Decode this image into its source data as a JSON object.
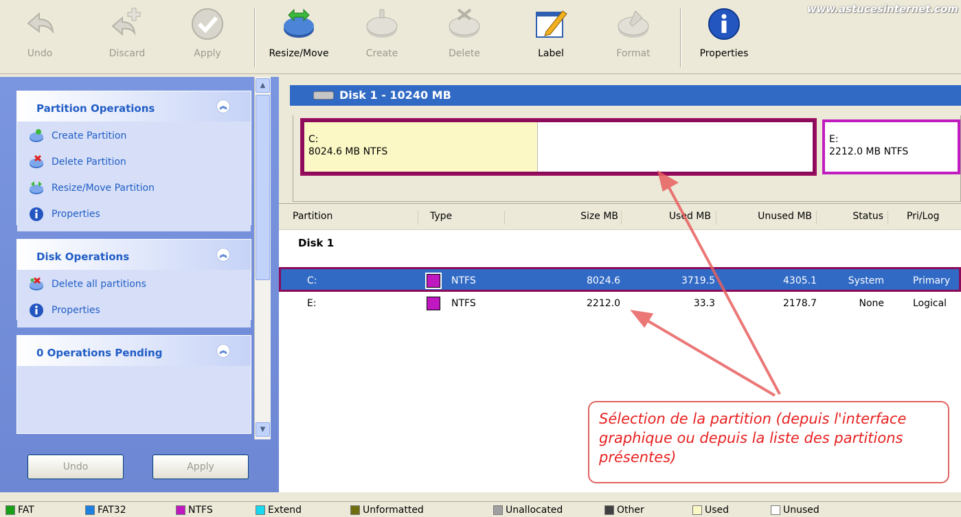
{
  "watermark": "www.astucesinternet.com",
  "toolbar": {
    "undo": "Undo",
    "discard": "Discard",
    "apply": "Apply",
    "resize_move": "Resize/Move",
    "create": "Create",
    "delete": "Delete",
    "label": "Label",
    "format": "Format",
    "properties": "Properties"
  },
  "sidebar": {
    "partition_ops": {
      "title": "Partition Operations",
      "items": [
        "Create Partition",
        "Delete Partition",
        "Resize/Move Partition",
        "Properties"
      ]
    },
    "disk_ops": {
      "title": "Disk Operations",
      "items": [
        "Delete all partitions",
        "Properties"
      ]
    },
    "pending": {
      "title": "0 Operations Pending"
    },
    "undo": "Undo",
    "apply": "Apply"
  },
  "disk": {
    "title": "Disk 1 - 10240 MB",
    "partC": {
      "letter": "C:",
      "info": "8024.6 MB  NTFS",
      "used_fraction": 0.46
    },
    "partE": {
      "letter": "E:",
      "info": "2212.0 MB  NTFS"
    }
  },
  "table": {
    "headers": [
      "Partition",
      "Type",
      "Size MB",
      "Used MB",
      "Unused MB",
      "Status",
      "Pri/Log"
    ],
    "disk_label": "Disk 1",
    "rows": [
      {
        "partition": "C:",
        "type": "NTFS",
        "size": "8024.6",
        "used": "3719.5",
        "unused": "4305.1",
        "status": "System",
        "prilog": "Primary"
      },
      {
        "partition": "E:",
        "type": "NTFS",
        "size": "2212.0",
        "used": "33.3",
        "unused": "2178.7",
        "status": "None",
        "prilog": "Logical"
      }
    ]
  },
  "callout": "Sélection de la partition (depuis l'interface graphique ou depuis la liste des partitions présentes)",
  "legend": [
    {
      "label": "FAT",
      "color": "#18a018"
    },
    {
      "label": "FAT32",
      "color": "#1c80e0"
    },
    {
      "label": "NTFS",
      "color": "#c018c0"
    },
    {
      "label": "Extend",
      "color": "#18d8f0"
    },
    {
      "label": "Unformatted",
      "color": "#6e6e10"
    },
    {
      "label": "Unallocated",
      "color": "#a0a0a0"
    },
    {
      "label": "Other",
      "color": "#404040"
    },
    {
      "label": "Used",
      "color": "#fbf8c6"
    },
    {
      "label": "Unused",
      "color": "#ffffff"
    }
  ],
  "colors": {
    "selection": "#316ac5",
    "accent": "#215dc6",
    "ntfs": "#c018c0",
    "highlight": "#8b0a5a"
  }
}
